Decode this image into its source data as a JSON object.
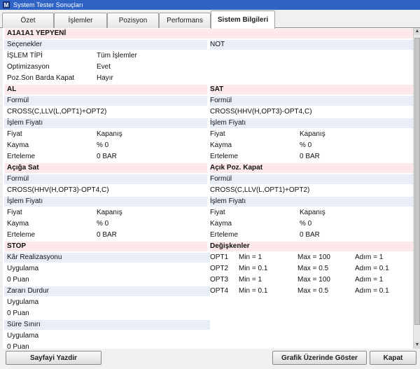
{
  "window": {
    "title": "System Tester Sonuçları",
    "icon_letter": "M"
  },
  "tabs": [
    "Özet",
    "İşlemler",
    "Pozisyon",
    "Performans",
    "Sistem Bilgileri"
  ],
  "system": {
    "name": "A1A1A1 YEPYENİ",
    "options_header": "Seçenekler",
    "note_header": "NOT",
    "options": [
      {
        "label": "İŞLEM TİPİ",
        "value": "Tüm İşlemler"
      },
      {
        "label": "Optimizasyon",
        "value": "Evet"
      },
      {
        "label": "Poz.Son Barda Kapat",
        "value": "Hayır"
      }
    ]
  },
  "sections": {
    "al": {
      "title": "AL",
      "formula_label": "Formül",
      "formula": "CROSS(C,LLV(L,OPT1)+OPT2)",
      "price_header": "İşlem Fiyatı",
      "rows": [
        {
          "label": "Fiyat",
          "value": "Kapanış"
        },
        {
          "label": "Kayma",
          "value": "% 0"
        },
        {
          "label": "Erteleme",
          "value": "0 BAR"
        }
      ]
    },
    "sat": {
      "title": "SAT",
      "formula_label": "Formül",
      "formula": "CROSS(HHV(H,OPT3)-OPT4,C)",
      "price_header": "İşlem Fiyatı",
      "rows": [
        {
          "label": "Fiyat",
          "value": "Kapanış"
        },
        {
          "label": "Kayma",
          "value": "% 0"
        },
        {
          "label": "Erteleme",
          "value": "0 BAR"
        }
      ]
    },
    "aciga_sat": {
      "title": "Açığa Sat",
      "formula_label": "Formül",
      "formula": "CROSS(HHV(H,OPT3)-OPT4,C)",
      "price_header": "İşlem Fiyatı",
      "rows": [
        {
          "label": "Fiyat",
          "value": "Kapanış"
        },
        {
          "label": "Kayma",
          "value": "% 0"
        },
        {
          "label": "Erteleme",
          "value": "0 BAR"
        }
      ]
    },
    "acik_poz_kapat": {
      "title": "Açık Poz. Kapat",
      "formula_label": "Formül",
      "formula": "CROSS(C,LLV(L,OPT1)+OPT2)",
      "price_header": "İşlem Fiyatı",
      "rows": [
        {
          "label": "Fiyat",
          "value": "Kapanış"
        },
        {
          "label": "Kayma",
          "value": "% 0"
        },
        {
          "label": "Erteleme",
          "value": "0 BAR"
        }
      ]
    }
  },
  "stop": {
    "title": "STOP",
    "items": [
      {
        "header": "Kâr Realizasyonu",
        "apply": "Uygulama",
        "value": "0 Puan"
      },
      {
        "header": "Zararı Durdur",
        "apply": "Uygulama",
        "value": "0 Puan"
      },
      {
        "header": "Süre Sınırı",
        "apply": "Uygulama",
        "value": "0 Puan"
      }
    ]
  },
  "variables": {
    "title": "Değişkenler",
    "rows": [
      {
        "name": "OPT1",
        "min": "Min = 1",
        "max": "Max = 100",
        "step": "Adım = 1"
      },
      {
        "name": "OPT2",
        "min": "Min = 0.1",
        "max": "Max = 0.5",
        "step": "Adım = 0.1"
      },
      {
        "name": "OPT3",
        "min": "Min = 1",
        "max": "Max = 100",
        "step": "Adım = 1"
      },
      {
        "name": "OPT4",
        "min": "Min = 0.1",
        "max": "Max = 0.5",
        "step": "Adım = 0.1"
      }
    ]
  },
  "buttons": {
    "print": "Sayfayi Yazdir",
    "show_on_chart": "Grafik Üzerinde Göster",
    "close": "Kapat"
  }
}
